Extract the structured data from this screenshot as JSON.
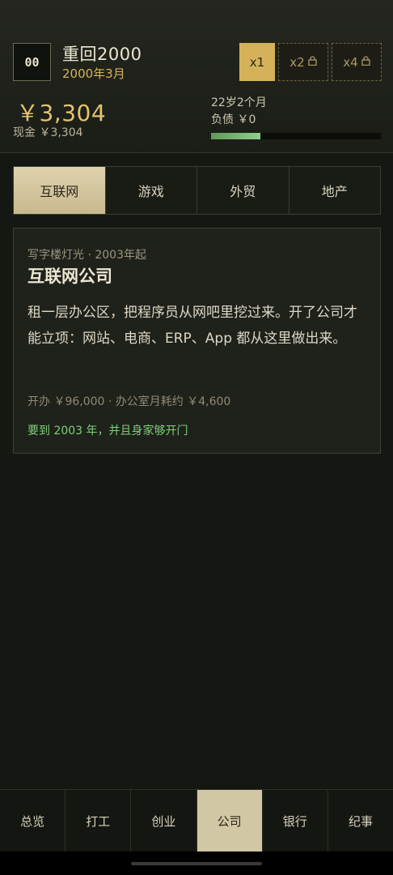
{
  "header": {
    "logo_text": "00",
    "title": "重回2000",
    "date": "2000年3月",
    "speeds": [
      {
        "label": "x1",
        "locked": false,
        "active": true
      },
      {
        "label": "x2",
        "locked": true,
        "active": false
      },
      {
        "label": "x4",
        "locked": true,
        "active": false
      }
    ],
    "cash": "￥3,304",
    "cash_sub": "现金 ￥3,304",
    "age": "22岁2个月",
    "debt": "负债 ￥0",
    "progress": 0.29,
    "progress_color": "#8fd08a"
  },
  "tabs": [
    {
      "label": "互联网",
      "active": true
    },
    {
      "label": "游戏",
      "active": false
    },
    {
      "label": "外贸",
      "active": false
    },
    {
      "label": "地产",
      "active": false
    }
  ],
  "card": {
    "kicker": "写字楼灯光 · 2003年起",
    "title": "互联网公司",
    "description": "租一层办公区，把程序员从网吧里挖过来。开了公司才能立项：网站、电商、ERP、App 都从这里做出来。",
    "cost": "开办 ￥96,000 · 办公室月耗约 ￥4,600",
    "requirement": "要到 2003 年，并且身家够开门"
  },
  "nav": [
    {
      "label": "总览",
      "active": false
    },
    {
      "label": "打工",
      "active": false
    },
    {
      "label": "创业",
      "active": false
    },
    {
      "label": "公司",
      "active": true
    },
    {
      "label": "银行",
      "active": false
    },
    {
      "label": "纪事",
      "active": false
    }
  ],
  "colors": {
    "accent_gold": "#d5b25a",
    "background": "#151712",
    "requirement_green": "#7fcf7b"
  }
}
